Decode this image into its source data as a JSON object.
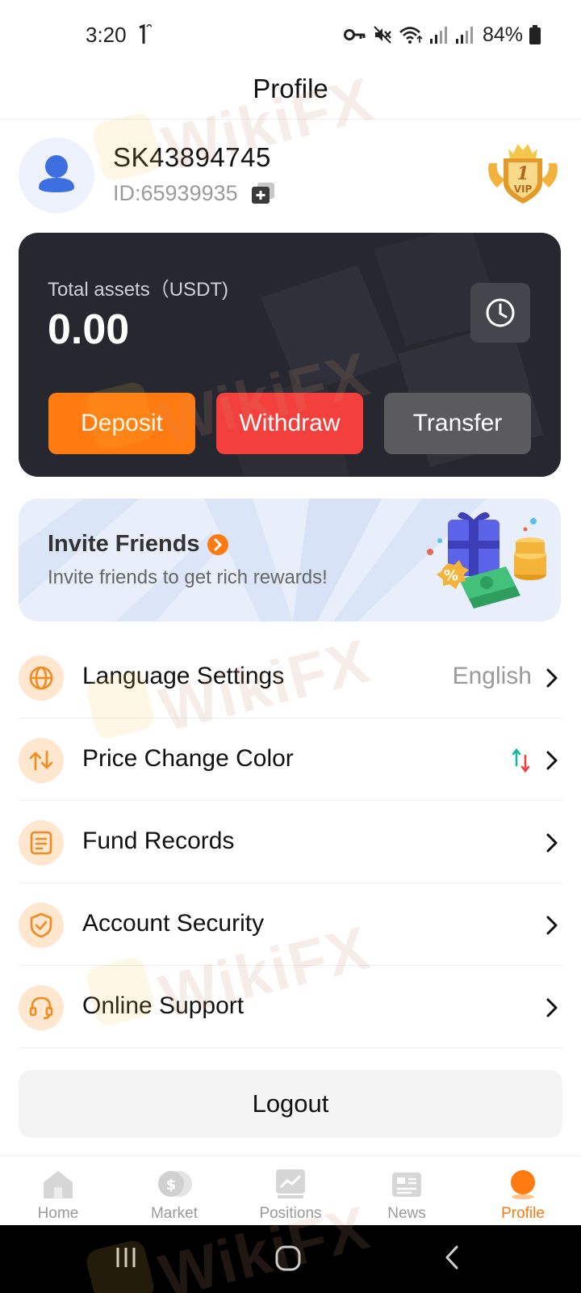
{
  "status_bar": {
    "time": "3:20",
    "battery": "84%",
    "icons": [
      "key-icon",
      "mute-icon",
      "wifi-icon",
      "signal-icon",
      "signal-icon",
      "battery-icon"
    ]
  },
  "header": {
    "title": "Profile"
  },
  "profile": {
    "username": "SK43894745",
    "user_id": "ID:65939935",
    "vip_level": "1",
    "vip_text": "VIP"
  },
  "assets": {
    "label": "Total assets（USDT)",
    "value": "0.00",
    "deposit_label": "Deposit",
    "withdraw_label": "Withdraw",
    "transfer_label": "Transfer"
  },
  "invite": {
    "title": "Invite Friends",
    "subtitle": "Invite friends to get rich rewards!",
    "badge_symbol": "%"
  },
  "menu": [
    {
      "label": "Language Settings",
      "value": "English",
      "icon": "globe-icon"
    },
    {
      "label": "Price Change Color",
      "value": "",
      "icon": "swap-arrows-icon"
    },
    {
      "label": "Fund Records",
      "value": "",
      "icon": "document-icon"
    },
    {
      "label": "Account Security",
      "value": "",
      "icon": "shield-check-icon"
    },
    {
      "label": "Online Support",
      "value": "",
      "icon": "headset-icon"
    }
  ],
  "logout_label": "Logout",
  "bottom_nav": [
    {
      "label": "Home",
      "icon": "home-icon",
      "active": false
    },
    {
      "label": "Market",
      "icon": "dollar-coin-icon",
      "active": false
    },
    {
      "label": "Positions",
      "icon": "chart-icon",
      "active": false
    },
    {
      "label": "News",
      "icon": "newspaper-icon",
      "active": false
    },
    {
      "label": "Profile",
      "icon": "profile-icon",
      "active": true
    }
  ],
  "watermark_text": "WikiFX",
  "colors": {
    "accent": "#ff7a10",
    "withdraw": "#f4403c",
    "transfer": "#5b5b5e",
    "card_bg": "#27282f",
    "price_up": "#16b79a",
    "price_down": "#f4403c"
  }
}
